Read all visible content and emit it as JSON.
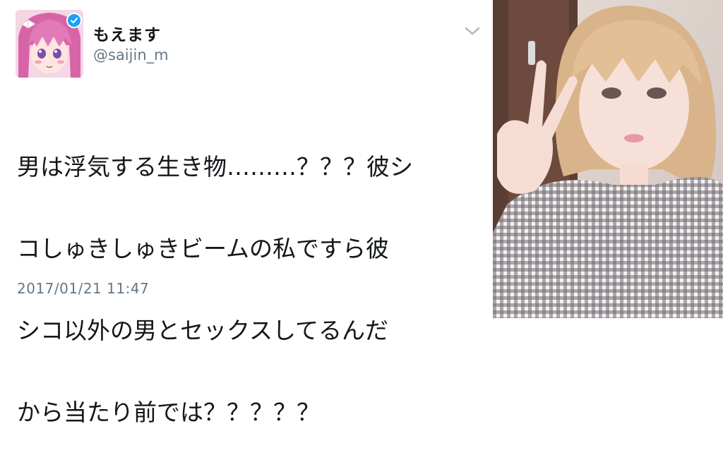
{
  "tweet": {
    "display_name": "もえます",
    "handle": "@saijin_m",
    "text_lines": [
      "男は浮気する生き物………？？？彼シ",
      "コしゅきしゅきビームの私ですら彼",
      "シコ以外の男とセックスしてるんだ",
      "から当たり前では？？？？？"
    ],
    "timestamp": "2017/01/21 11:47",
    "verified": true
  },
  "icons": {
    "verified": "verified-check-icon",
    "menu": "chevron-down-icon"
  },
  "colors": {
    "verified_blue": "#1da1f2",
    "text": "#14171a",
    "secondary_text": "#657786"
  }
}
